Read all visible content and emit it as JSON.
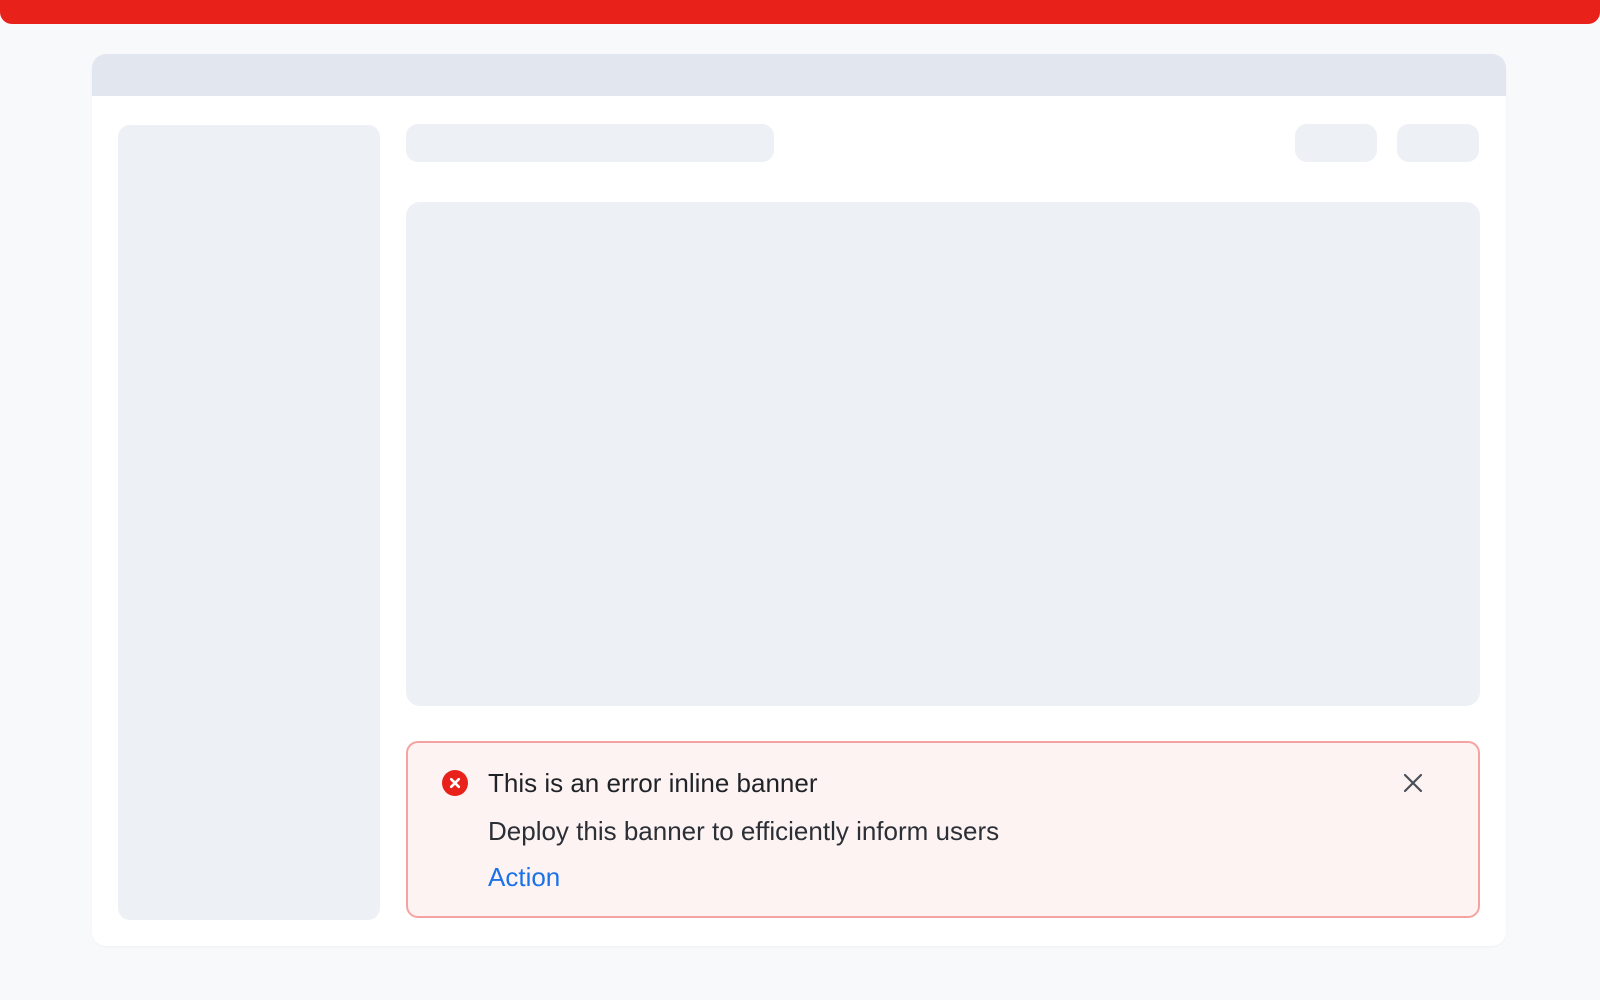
{
  "banner": {
    "variant": "error",
    "title": "This is an error inline banner",
    "message": "Deploy this banner to efficiently inform users",
    "action_label": "Action",
    "icon": "error-circle-icon",
    "close_icon": "close-icon"
  },
  "colors": {
    "accent": "#e8211a",
    "banner_background": "#fef3f3",
    "banner_border": "#f5a3a1",
    "action_link": "#1a73e8",
    "skeleton": "#edf0f5",
    "titlebar": "#e2e6ee"
  }
}
